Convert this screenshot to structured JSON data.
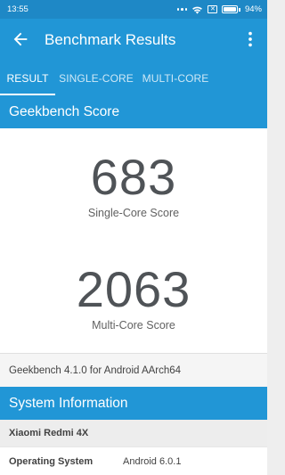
{
  "status_bar": {
    "time": "13:55",
    "battery_label": "94%",
    "battery_level": 0.94
  },
  "app_bar": {
    "title": "Benchmark Results",
    "back_icon": "arrow-back-icon",
    "more_icon": "more-vert-icon"
  },
  "tabs": [
    {
      "label": "RESULT",
      "active": true
    },
    {
      "label": "SINGLE-CORE",
      "active": false
    },
    {
      "label": "MULTI-CORE",
      "active": false
    }
  ],
  "geekbench_section": {
    "title": "Geekbench Score",
    "single_core_score": "683",
    "single_core_label": "Single-Core Score",
    "multi_core_score": "2063",
    "multi_core_label": "Multi-Core Score",
    "version": "Geekbench 4.1.0 for Android AArch64"
  },
  "system_info": {
    "title": "System Information",
    "device_name": "Xiaomi Redmi 4X",
    "rows": [
      {
        "key": "Operating System",
        "value": "Android 6.0.1"
      }
    ]
  },
  "colors": {
    "primary": "#2196d6",
    "status_bar": "#1e88c6",
    "score_text": "#4f5357"
  }
}
